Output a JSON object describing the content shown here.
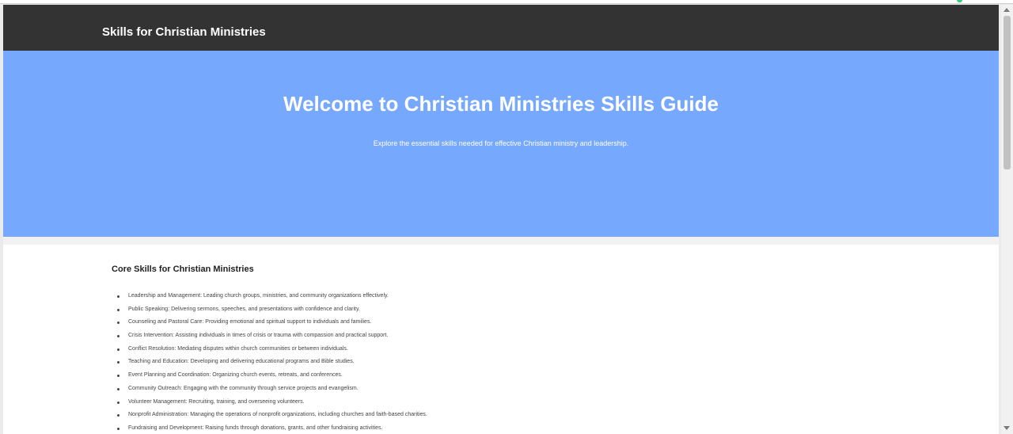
{
  "header": {
    "site_title": "Skills for Christian Ministries"
  },
  "hero": {
    "title": "Welcome to Christian Ministries Skills Guide",
    "subtitle": "Explore the essential skills needed for effective Christian ministry and leadership."
  },
  "core_skills": {
    "heading": "Core Skills for Christian Ministries",
    "items": [
      "Leadership and Management: Leading church groups, ministries, and community organizations effectively.",
      "Public Speaking: Delivering sermons, speeches, and presentations with confidence and clarity.",
      "Counseling and Pastoral Care: Providing emotional and spiritual support to individuals and families.",
      "Crisis Intervention: Assisting individuals in times of crisis or trauma with compassion and practical support.",
      "Conflict Resolution: Mediating disputes within church communities or between individuals.",
      "Teaching and Education: Developing and delivering educational programs and Bible studies.",
      "Event Planning and Coordination: Organizing church events, retreats, and conferences.",
      "Community Outreach: Engaging with the community through service projects and evangelism.",
      "Volunteer Management: Recruiting, training, and overseeing volunteers.",
      "Nonprofit Administration: Managing the operations of nonprofit organizations, including churches and faith-based charities.",
      "Fundraising and Development: Raising funds through donations, grants, and other fundraising activities."
    ]
  },
  "colors": {
    "header_background": "#333333",
    "hero_background": "#76a8fd",
    "content_background": "#ffffff",
    "page_background": "#f2f2f2",
    "accent_indicator": "#35d07a"
  },
  "icons": {
    "scroll_up": "chevron-up-icon",
    "scroll_down": "chevron-down-icon",
    "list_bullet": "bullet-icon"
  }
}
